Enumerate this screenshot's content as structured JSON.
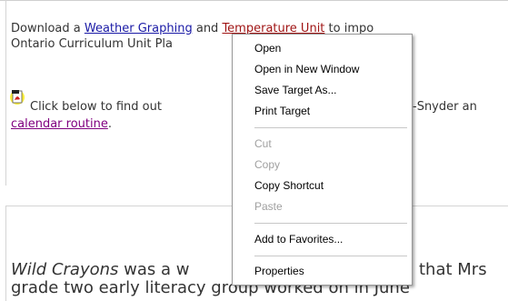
{
  "content": {
    "line1_prefix": "Download a ",
    "link_weather": "Weather Graphing",
    "line1_mid": " and ",
    "link_temperature": "Temperature Unit",
    "line1_suffix": " to impo",
    "line2": "Ontario Curriculum Unit Pla",
    "line3_prefix": "Click below to find out",
    "line3_suffix": "-Snyder an",
    "link_calendar": "calendar routine",
    "link_calendar_period": ".",
    "bottom_line1_italic": "Wild Crayons",
    "bottom_line1_mid": " was a w",
    "bottom_line1_suffix": "that Mrs",
    "bottom_line2": "grade two early literacy group worked on in June"
  },
  "context_menu": {
    "items": [
      {
        "label": "Open",
        "enabled": true
      },
      {
        "label": "Open in New Window",
        "enabled": true
      },
      {
        "label": "Save Target As...",
        "enabled": true
      },
      {
        "label": "Print Target",
        "enabled": true
      },
      {
        "label": "Cut",
        "enabled": false
      },
      {
        "label": "Copy",
        "enabled": false
      },
      {
        "label": "Copy Shortcut",
        "enabled": true
      },
      {
        "label": "Paste",
        "enabled": false
      },
      {
        "label": "Add to Favorites...",
        "enabled": true
      },
      {
        "label": "Properties",
        "enabled": true
      }
    ]
  },
  "colors": {
    "link_blue": "#1a1aa6",
    "link_red": "#a01515",
    "link_purple": "#800080",
    "disabled_text": "#a0a0a0"
  },
  "icons": {
    "pdf": "pdf-document-icon"
  }
}
